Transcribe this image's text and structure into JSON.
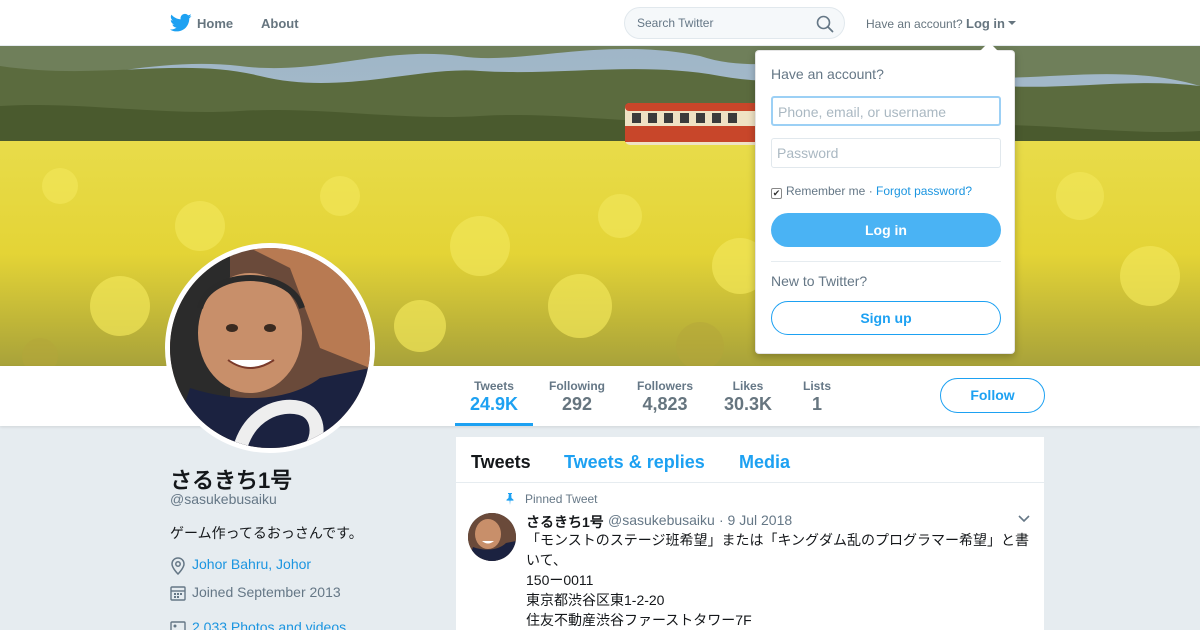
{
  "nav": {
    "home_label": "Home",
    "about_label": "About",
    "search_placeholder": "Search Twitter",
    "have_account": "Have an account?",
    "login_label": "Log in"
  },
  "profile": {
    "name": "さるきち1号",
    "handle": "@sasukebusaiku",
    "bio": "ゲーム作ってるおっさんです。",
    "location": "Johor Bahru, Johor",
    "joined": "Joined September 2013",
    "photos": "2,033 Photos and videos"
  },
  "stats": [
    {
      "label": "Tweets",
      "value": "24.9K"
    },
    {
      "label": "Following",
      "value": "292"
    },
    {
      "label": "Followers",
      "value": "4,823"
    },
    {
      "label": "Likes",
      "value": "30.3K"
    },
    {
      "label": "Lists",
      "value": "1"
    }
  ],
  "follow_label": "Follow",
  "timeline": {
    "tabs": [
      "Tweets",
      "Tweets & replies",
      "Media"
    ],
    "pinned_label": "Pinned Tweet",
    "tweet": {
      "name": "さるきち1号",
      "handle": "@sasukebusaiku",
      "date": "· 9 Jul 2018",
      "lines": [
        "「モンストのステージ班希望」または「キングダム乱のプログラマー希望」と書",
        "いて、",
        "150ー0011",
        "東京都渋谷区東1-2-20",
        "住友不動産渋谷ファーストタワー7F"
      ]
    }
  },
  "login_dropdown": {
    "heading": "Have an account?",
    "username_placeholder": "Phone, email, or username",
    "password_placeholder": "Password",
    "remember_label": "Remember me",
    "separator": "·",
    "forgot_label": "Forgot password?",
    "login_button": "Log in",
    "new_label": "New to Twitter?",
    "signup_button": "Sign up"
  },
  "colors": {
    "accent": "#1da1f2",
    "link": "#1b95e0",
    "muted": "#657786",
    "background": "#e6ecf0"
  },
  "icons": [
    "twitter-bird-icon",
    "search-icon",
    "caret-down-icon",
    "location-pin-icon",
    "calendar-icon",
    "photo-icon",
    "pin-icon",
    "chevron-down-icon"
  ]
}
